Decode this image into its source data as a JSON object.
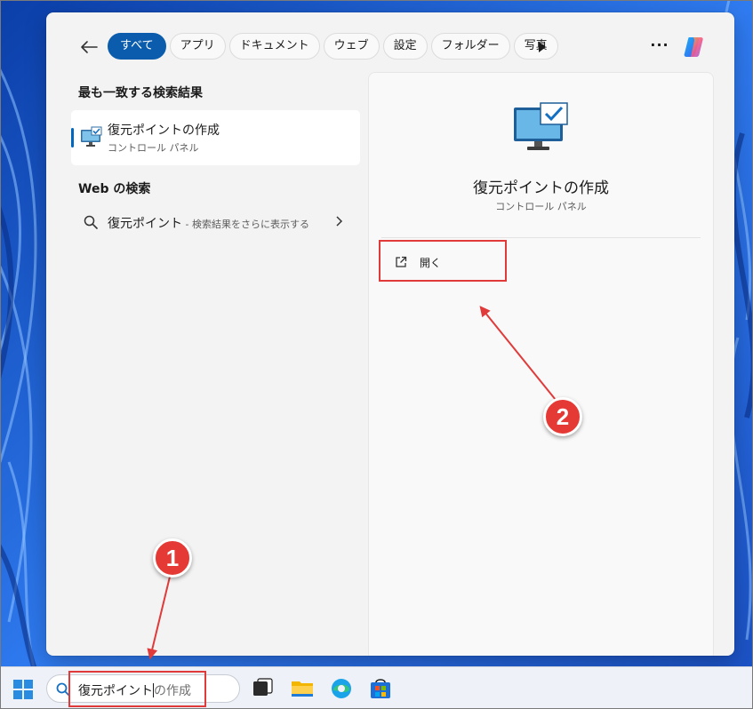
{
  "filters": [
    {
      "label": "すべて",
      "active": true
    },
    {
      "label": "アプリ"
    },
    {
      "label": "ドキュメント"
    },
    {
      "label": "ウェブ"
    },
    {
      "label": "設定"
    },
    {
      "label": "フォルダー"
    },
    {
      "label": "写真"
    }
  ],
  "best_match": {
    "heading": "最も一致する検索結果",
    "title": "復元ポイントの作成",
    "subtitle": "コントロール パネル"
  },
  "web_search": {
    "heading": "Web の検索",
    "query": "復元ポイント",
    "hint": " - 検索結果をさらに表示する"
  },
  "preview": {
    "title": "復元ポイントの作成",
    "subtitle": "コントロール パネル",
    "open_label": "開く"
  },
  "taskbar": {
    "search_typed": "復元ポイント",
    "search_ghost": "の作成",
    "apps": [
      "task-view",
      "file-explorer",
      "edge",
      "microsoft-store"
    ]
  },
  "annotations": {
    "step1": "1",
    "step2": "2",
    "color": "#e53935"
  },
  "colors": {
    "accent": "#0b5cad",
    "panel": "#f3f3f3"
  }
}
